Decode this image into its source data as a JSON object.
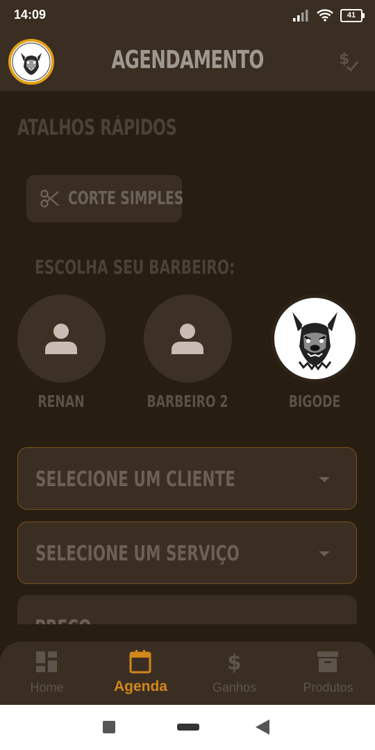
{
  "status_bar": {
    "time": "14:09",
    "battery": "41"
  },
  "app_bar": {
    "title": "AGENDAMENTO"
  },
  "shortcuts": {
    "title": "ATALHOS RÁPIDOS",
    "items": [
      {
        "label": "CORTE SIMPLES",
        "icon": "scissors-icon"
      }
    ]
  },
  "barbers": {
    "title": "ESCOLHA SEU BARBEIRO:",
    "items": [
      {
        "name": "RENAN",
        "avatar": "person-icon"
      },
      {
        "name": "BARBEIRO 2",
        "avatar": "person-icon"
      },
      {
        "name": "BIGODE",
        "avatar": "pitbull-logo",
        "selected": true
      }
    ]
  },
  "form": {
    "client_placeholder": "SELECIONE UM CLIENTE",
    "service_placeholder": "SELECIONE UM SERVIÇO",
    "price_label": "PREÇO"
  },
  "bottom_nav": {
    "items": [
      {
        "label": "Home",
        "icon": "dashboard-icon"
      },
      {
        "label": "Agenda",
        "icon": "calendar-icon",
        "active": true
      },
      {
        "label": "Ganhos",
        "icon": "dollar-icon"
      },
      {
        "label": "Produtos",
        "icon": "archive-icon"
      }
    ]
  },
  "colors": {
    "background": "#281d11",
    "app_bar": "#3a2d21",
    "accent": "#d1871b",
    "avatar_ring": "#e0a018",
    "field_border": "#7a5420"
  }
}
